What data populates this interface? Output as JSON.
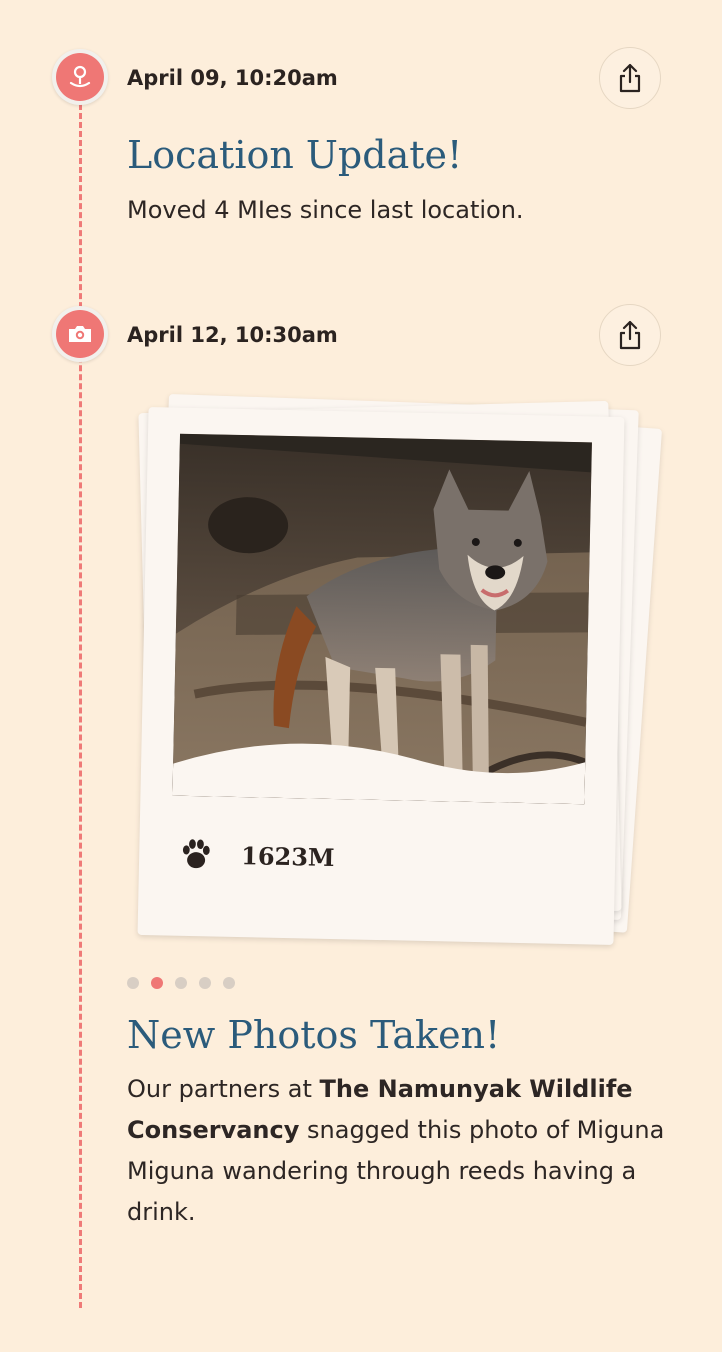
{
  "timeline": {
    "entries": [
      {
        "date": "April 09, 10:20am",
        "icon": "map-pin-icon",
        "title": "Location Update!",
        "description": "Moved 4 MIes since last location."
      },
      {
        "date": "April 12, 10:30am",
        "icon": "camera-icon",
        "title": "New Photos Taken!",
        "description_parts": {
          "before": "Our partners at ",
          "bold": "The Namunyak Wildlife Conservancy",
          "after": " snagged this photo of Miguna Miguna wandering through reeds having a drink."
        },
        "photo": {
          "caption": "1623M",
          "caption_icon": "paw-print-icon",
          "subject": "wolf"
        },
        "carousel": {
          "count": 5,
          "active_index": 1
        }
      }
    ]
  },
  "share_icon": "share-icon",
  "colors": {
    "background": "#fdeedb",
    "accent": "#ef7775",
    "title": "#2b5b7b",
    "timeline_line": "#ef7a78"
  }
}
